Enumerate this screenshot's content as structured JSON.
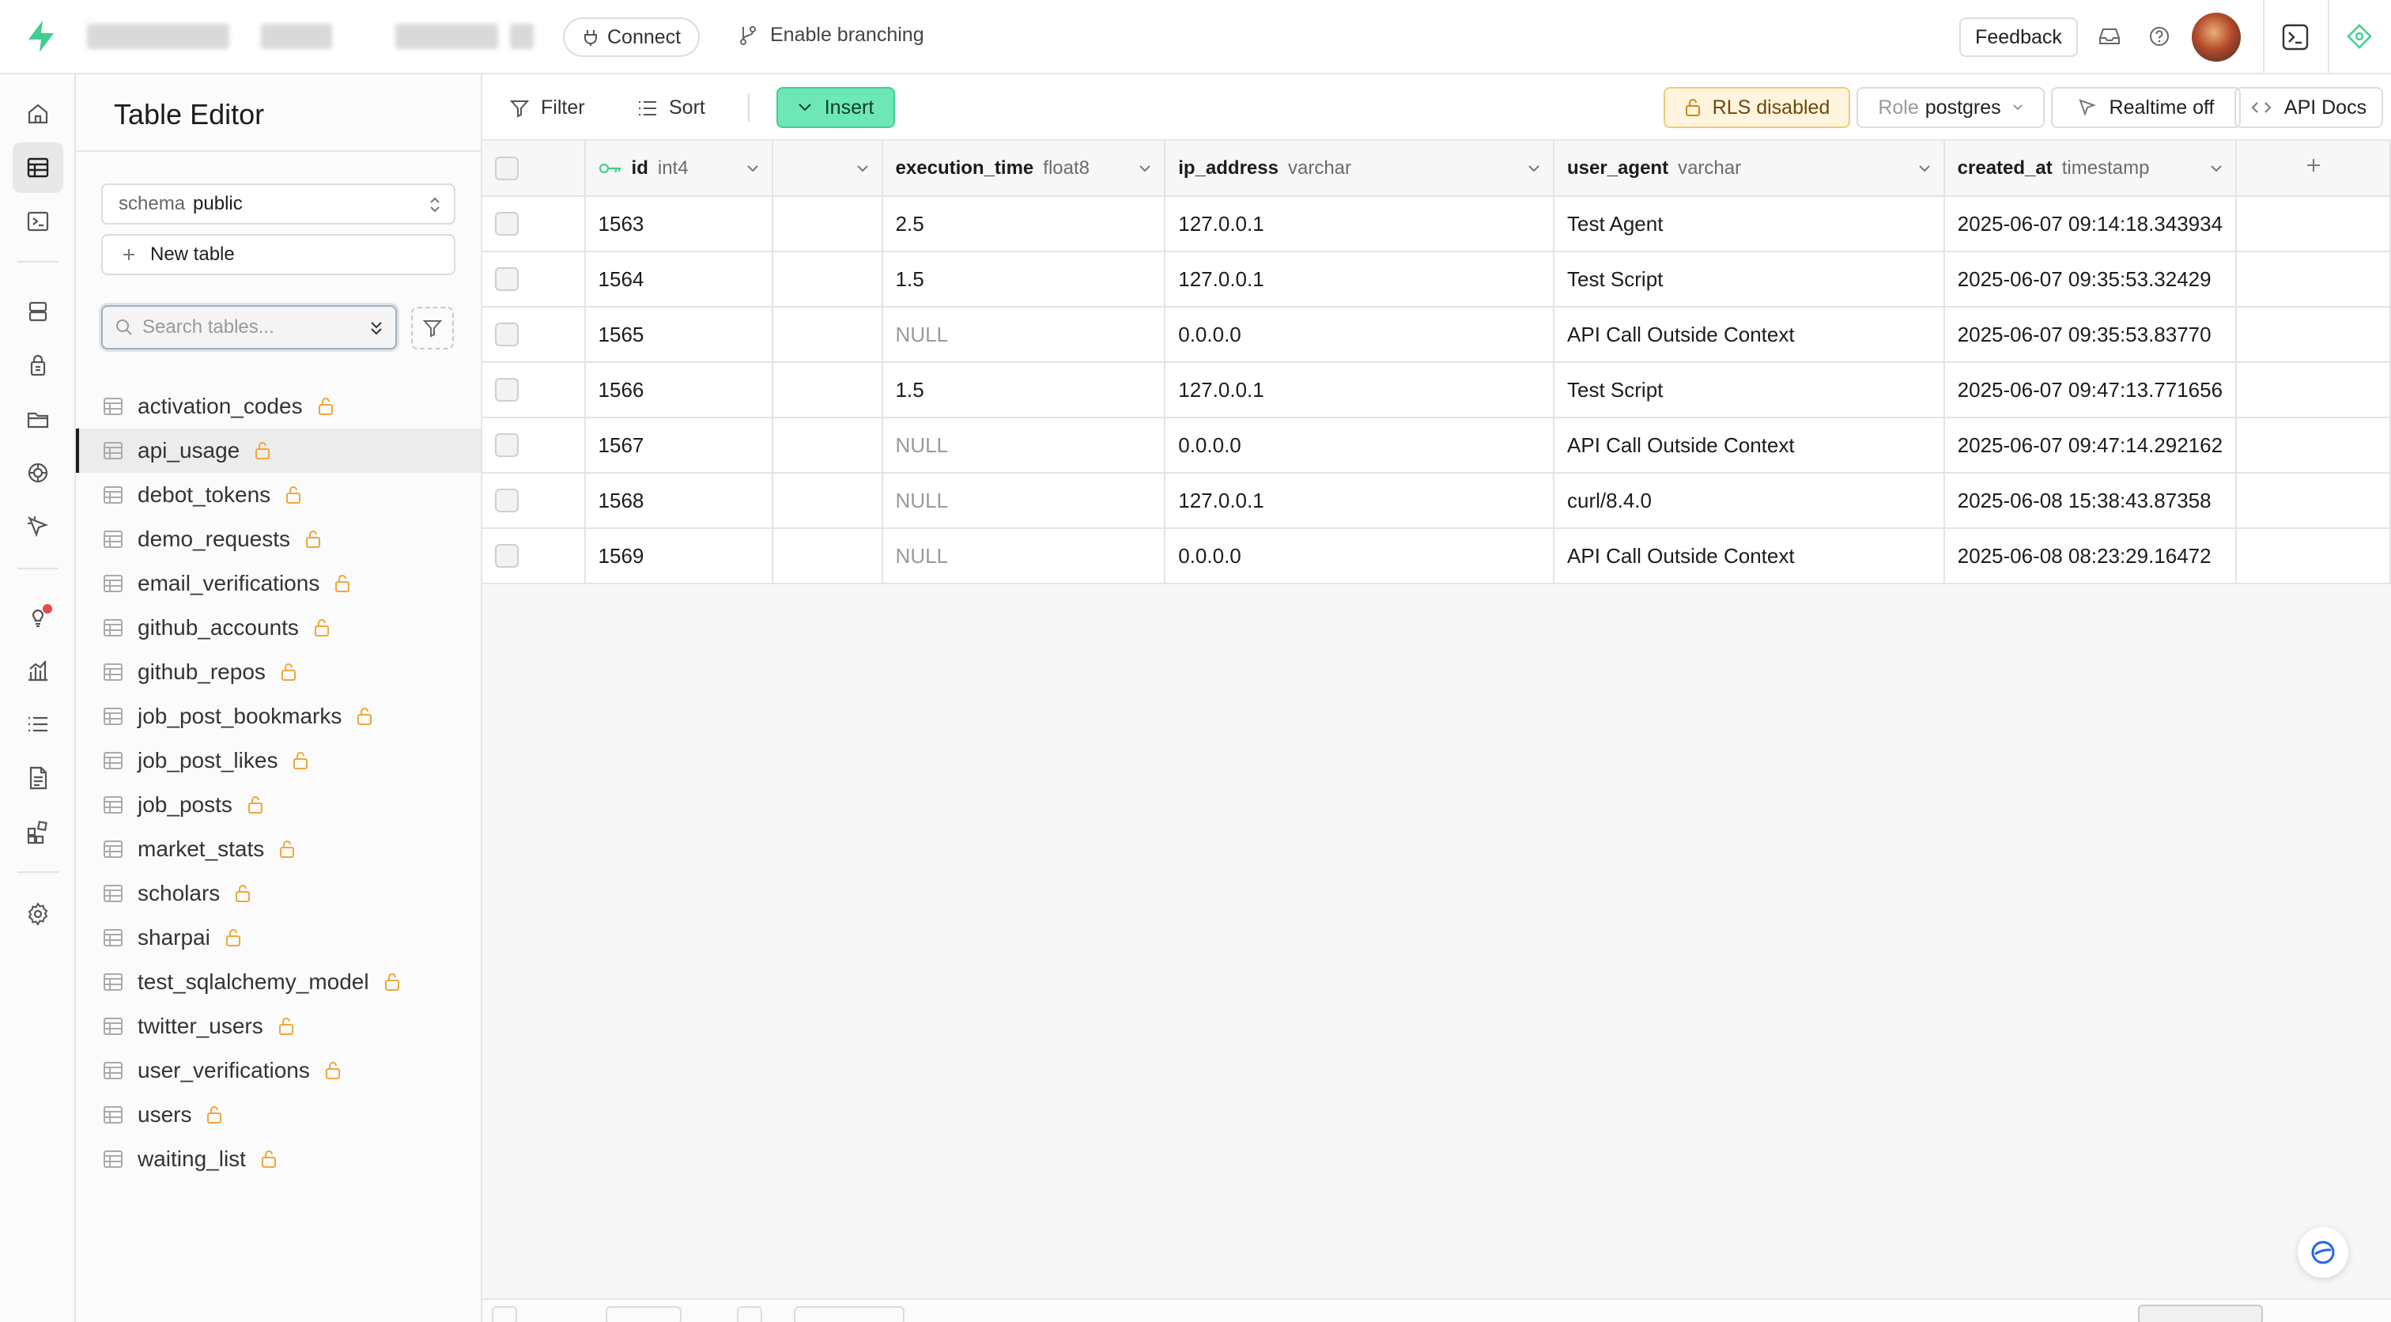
{
  "topbar": {
    "connect_label": "Connect",
    "branching_label": "Enable branching",
    "feedback_label": "Feedback"
  },
  "rail": {
    "items": [
      {
        "icon": "home-icon",
        "active": false
      },
      {
        "icon": "table-editor-icon",
        "active": true
      },
      {
        "icon": "sql-editor-icon",
        "active": false
      },
      {
        "icon": "database-icon",
        "active": false
      },
      {
        "icon": "auth-icon",
        "active": false
      },
      {
        "icon": "storage-icon",
        "active": false
      },
      {
        "icon": "realtime-icon",
        "active": false
      },
      {
        "icon": "edge-functions-icon",
        "active": false
      },
      {
        "icon": "advisors-icon",
        "active": false
      },
      {
        "icon": "reports-icon",
        "active": false
      },
      {
        "icon": "logs-icon",
        "active": false
      },
      {
        "icon": "api-docs-icon",
        "active": false
      },
      {
        "icon": "integrations-icon",
        "active": false
      },
      {
        "icon": "settings-icon",
        "active": false
      }
    ]
  },
  "sidebar": {
    "title": "Table Editor",
    "schema_label": "schema",
    "schema_value": "public",
    "new_table_label": "New table",
    "search_placeholder": "Search tables...",
    "tables": [
      {
        "name": "activation_codes",
        "active": false
      },
      {
        "name": "api_usage",
        "active": true
      },
      {
        "name": "debot_tokens",
        "active": false
      },
      {
        "name": "demo_requests",
        "active": false
      },
      {
        "name": "email_verifications",
        "active": false
      },
      {
        "name": "github_accounts",
        "active": false
      },
      {
        "name": "github_repos",
        "active": false
      },
      {
        "name": "job_post_bookmarks",
        "active": false
      },
      {
        "name": "job_post_likes",
        "active": false
      },
      {
        "name": "job_posts",
        "active": false
      },
      {
        "name": "market_stats",
        "active": false
      },
      {
        "name": "scholars",
        "active": false
      },
      {
        "name": "sharpai",
        "active": false
      },
      {
        "name": "test_sqlalchemy_model",
        "active": false
      },
      {
        "name": "twitter_users",
        "active": false
      },
      {
        "name": "user_verifications",
        "active": false
      },
      {
        "name": "users",
        "active": false
      },
      {
        "name": "waiting_list",
        "active": false
      }
    ]
  },
  "toolbar": {
    "filter_label": "Filter",
    "sort_label": "Sort",
    "insert_label": "Insert",
    "rls_label": "RLS disabled",
    "role_prefix": "Role",
    "role_value": "postgres",
    "realtime_label": "Realtime off",
    "api_docs_label": "API Docs"
  },
  "grid": {
    "columns": [
      {
        "name": "id",
        "type": "int4",
        "key": true
      },
      {
        "name": "",
        "type": "",
        "key": false
      },
      {
        "name": "execution_time",
        "type": "float8",
        "key": false
      },
      {
        "name": "ip_address",
        "type": "varchar",
        "key": false
      },
      {
        "name": "user_agent",
        "type": "varchar",
        "key": false
      },
      {
        "name": "created_at",
        "type": "timestamp",
        "key": false
      }
    ],
    "rows": [
      {
        "id": "1563",
        "execution_time": "2.5",
        "ip_address": "127.0.0.1",
        "user_agent": "Test Agent",
        "created_at": "2025-06-07 09:14:18.343934"
      },
      {
        "id": "1564",
        "execution_time": "1.5",
        "ip_address": "127.0.0.1",
        "user_agent": "Test Script",
        "created_at": "2025-06-07 09:35:53.32429"
      },
      {
        "id": "1565",
        "execution_time": "NULL",
        "ip_address": "0.0.0.0",
        "user_agent": "API Call Outside Context",
        "created_at": "2025-06-07 09:35:53.83770"
      },
      {
        "id": "1566",
        "execution_time": "1.5",
        "ip_address": "127.0.0.1",
        "user_agent": "Test Script",
        "created_at": "2025-06-07 09:47:13.771656"
      },
      {
        "id": "1567",
        "execution_time": "NULL",
        "ip_address": "0.0.0.0",
        "user_agent": "API Call Outside Context",
        "created_at": "2025-06-07 09:47:14.292162"
      },
      {
        "id": "1568",
        "execution_time": "NULL",
        "ip_address": "127.0.0.1",
        "user_agent": "curl/8.4.0",
        "created_at": "2025-06-08 15:38:43.87358"
      },
      {
        "id": "1569",
        "execution_time": "NULL",
        "ip_address": "0.0.0.0",
        "user_agent": "API Call Outside Context",
        "created_at": "2025-06-08 08:23:29.16472"
      }
    ]
  },
  "colors": {
    "brand_green": "#3fcf8e",
    "insert_bg": "#6ee7b7",
    "rls_bg": "#fff4de",
    "lock_orange": "#f0a63a"
  }
}
